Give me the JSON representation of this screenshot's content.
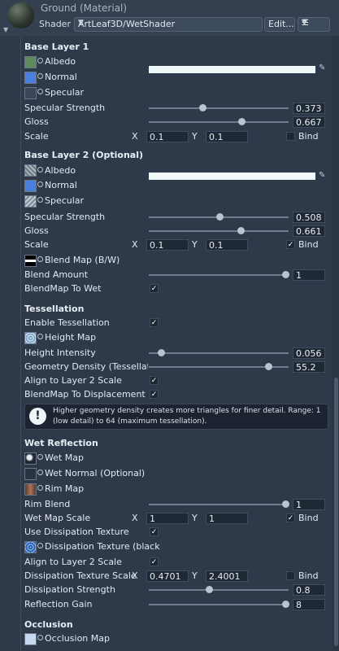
{
  "header": {
    "title": "Ground (Material)",
    "shader_label": "Shader",
    "shader_value": "ArtLeaf3D/WetShader",
    "edit_label": "Edit...",
    "menu_icon": "list-icon"
  },
  "base1": {
    "title": "Base Layer 1",
    "albedo": "Albedo",
    "normal": "Normal",
    "specular": "Specular",
    "spec_strength": {
      "label": "Specular Strength",
      "value": "0.373",
      "fraction": 0.373
    },
    "gloss": {
      "label": "Gloss",
      "value": "0.667",
      "fraction": 0.667
    },
    "scale": {
      "label": "Scale",
      "x_label": "X",
      "x": "0.1",
      "y_label": "Y",
      "y": "0.1",
      "bind_label": "Bind",
      "bind": false
    }
  },
  "base2": {
    "title": "Base Layer 2 (Optional)",
    "albedo": "Albedo",
    "normal": "Normal",
    "specular": "Specular",
    "spec_strength": {
      "label": "Specular Strength",
      "value": "0.508",
      "fraction": 0.508
    },
    "gloss": {
      "label": "Gloss",
      "value": "0.661",
      "fraction": 0.661
    },
    "scale": {
      "label": "Scale",
      "x_label": "X",
      "x": "0.1",
      "y_label": "Y",
      "y": "0.1",
      "bind_label": "Bind",
      "bind": true
    },
    "blend_map": "Blend Map (B/W)",
    "blend_amount": {
      "label": "Blend Amount",
      "value": "1",
      "fraction": 1.0
    },
    "blendmap_to_wet": {
      "label": "BlendMap To Wet",
      "checked": true
    }
  },
  "tess": {
    "title": "Tessellation",
    "enable": {
      "label": "Enable Tessellation",
      "checked": true
    },
    "height_map": "Height Map",
    "height_intensity": {
      "label": "Height Intensity",
      "value": "0.056",
      "fraction": 0.056
    },
    "geometry_density": {
      "label": "Geometry Density (Tessellation",
      "value": "55.2",
      "fraction": 0.86
    },
    "align": {
      "label": "Align to Layer 2 Scale",
      "checked": true
    },
    "blendmap_disp": {
      "label": "BlendMap To Displacement",
      "checked": true
    },
    "help": "Higher geometry density creates more triangles for finer detail. Range: 1 (low detail) to 64 (maximum tessellation)."
  },
  "wet": {
    "title": "Wet Reflection",
    "wet_map": "Wet Map",
    "wet_normal": "Wet Normal (Optional)",
    "rim_map": "Rim Map",
    "rim_blend": {
      "label": "Rim Blend",
      "value": "1",
      "fraction": 1.0
    },
    "wet_map_scale": {
      "label": "Wet Map Scale",
      "x_label": "X",
      "x": "1",
      "y_label": "Y",
      "y": "1",
      "bind_label": "Bind",
      "bind": true
    },
    "use_diss": {
      "label": "Use Dissipation Texture",
      "checked": true
    },
    "diss_tex": "Dissipation Texture (black",
    "align": {
      "label": "Align to Layer 2 Scale",
      "checked": true
    },
    "diss_scale": {
      "label": "Dissipation Texture Scale",
      "x_label": "X",
      "x": "0.4701",
      "y_label": "Y",
      "y": "2.4001",
      "bind_label": "Bind",
      "bind": false
    },
    "diss_strength": {
      "label": "Dissipation Strength",
      "value": "0.8",
      "fraction": 0.8
    },
    "reflection_gain": {
      "label": "Reflection Gain",
      "value": "8",
      "fraction": 1.0
    }
  },
  "occlusion": {
    "title": "Occlusion",
    "map": "Occlusion Map"
  },
  "colors": {
    "background": "#2e3a4a",
    "field": "#1f2935",
    "accent_blue": "#4a7fe0"
  }
}
